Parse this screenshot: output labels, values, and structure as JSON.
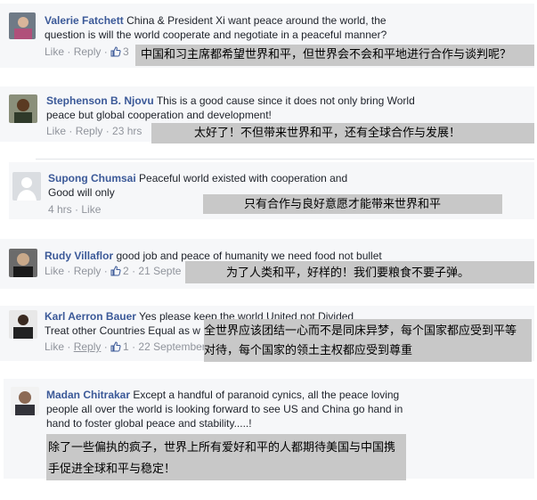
{
  "comments": [
    {
      "author": "Valerie Fatchett",
      "text": "China & President Xi want peace around the world, the question is will the world cooperate and negotiate in a peaceful manner?",
      "actions": [
        "Like",
        "Reply"
      ],
      "likes": "3",
      "translation": "中国和习主席都希望世界和平，但世界会不会和平地进行合作与谈判呢？"
    },
    {
      "author": "Stephenson B. Njovu",
      "text": "This is a good cause since it does not only bring World peace but global cooperation and development!",
      "actions": [
        "Like",
        "Reply"
      ],
      "time": "23 hrs",
      "translation": "太好了！不但带来世界和平，还有全球合作与发展！"
    },
    {
      "author": "Supong Chumsai",
      "text": "Peaceful world existed with cooperation and Good will only",
      "time": "4 hrs",
      "actions": [
        "Like"
      ],
      "translation": "只有合作与良好意愿才能带来世界和平"
    },
    {
      "author": "Rudy Villaflor",
      "text": "good job and peace of humanity we need food not bullet",
      "actions": [
        "Like",
        "Reply"
      ],
      "likes": "2",
      "time": "21 Septe",
      "translation": "为了人类和平，好样的！我们要粮食不要子弹。"
    },
    {
      "author": "Karl Aerron Bauer",
      "text": "Yes please keep the world United not Divided Treat other Countries Equal as w",
      "actions": [
        "Like",
        "Reply"
      ],
      "likes": "1",
      "time": "22 September",
      "translation": "全世界应该团结一心而不是同床异梦，每个国家都应受到平等对待，每个国家的领土主权都应受到尊重"
    },
    {
      "author": "Madan Chitrakar",
      "text": "Except a handful of paranoid cynics, all the peace loving people all over the world is looking forward to see US and China go hand in hand to foster global peace and stability.....!",
      "translation": "除了一些偏执的疯子，世界上所有爱好和平的人都期待美国与中国携手促进全球和平与稳定！"
    }
  ],
  "colors": {
    "name": "#3b5998",
    "card_bg": "#f6f7f9",
    "overlay_bg": "#c8c8c8",
    "meta": "#90949c"
  }
}
